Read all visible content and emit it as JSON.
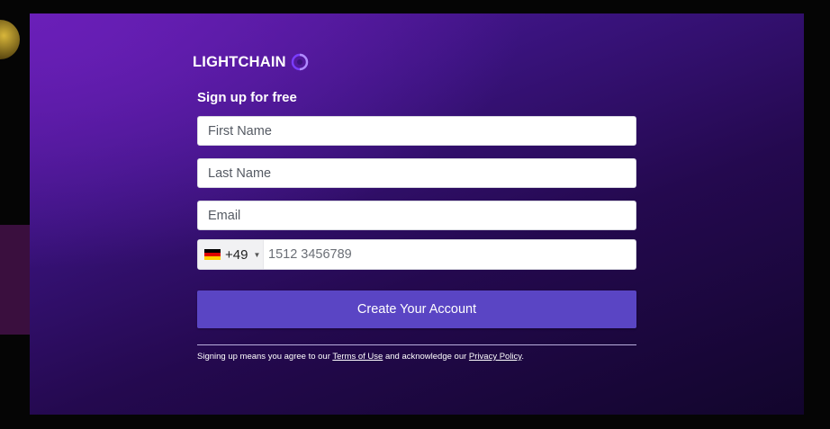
{
  "brand": {
    "name": "LIGHTCHAIN",
    "accent": "#5a45c4",
    "background_top": "#5a1aa6",
    "background_bottom": "#12052c"
  },
  "form": {
    "heading": "Sign up for free",
    "first_name": {
      "placeholder": "First Name",
      "value": ""
    },
    "last_name": {
      "placeholder": "Last Name",
      "value": ""
    },
    "email": {
      "placeholder": "Email",
      "value": ""
    },
    "phone": {
      "country_flag": "germany-flag",
      "dial_code": "+49",
      "placeholder": "1512 3456789"
    },
    "submit_label": "Create Your Account"
  },
  "legal": {
    "prefix": "Signing up means you agree to our ",
    "terms_link": "Terms of Use",
    "middle": " and acknowledge our ",
    "privacy_link": "Privacy Policy",
    "suffix": "."
  }
}
